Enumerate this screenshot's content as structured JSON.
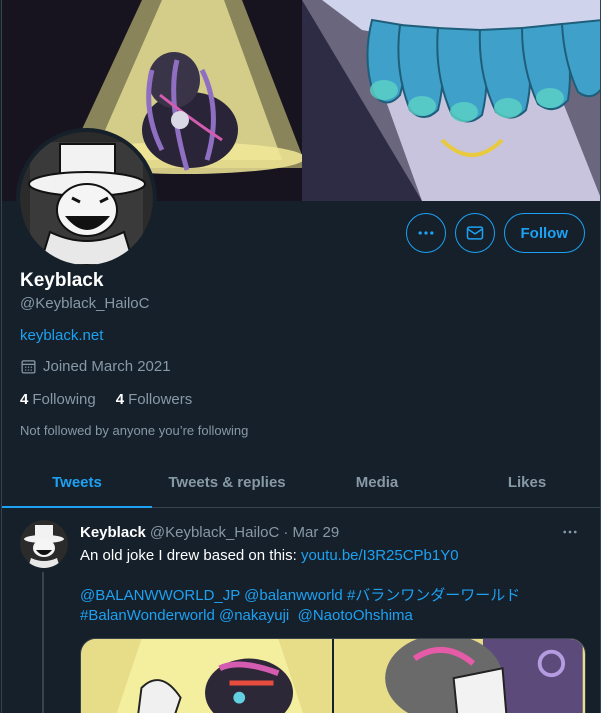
{
  "profile": {
    "name": "Keyblack",
    "handle": "@Keyblack_HailoC",
    "website": "keyblack.net",
    "joined": "Joined March 2021",
    "following_count": "4",
    "following_label": "Following",
    "followers_count": "4",
    "followers_label": "Followers",
    "not_followed": "Not followed by anyone you’re following"
  },
  "actions": {
    "more_icon": "more-horizontal-icon",
    "message_icon": "envelope-icon",
    "follow_label": "Follow"
  },
  "tabs": [
    {
      "label": "Tweets",
      "active": true
    },
    {
      "label": "Tweets & replies",
      "active": false
    },
    {
      "label": "Media",
      "active": false
    },
    {
      "label": "Likes",
      "active": false
    }
  ],
  "tweet": {
    "name": "Keyblack",
    "handle": "@Keyblack_HailoC",
    "date": "· Mar 29",
    "text": "An old joke I drew based on this:",
    "link": "youtu.be/I3R25CPb1Y0",
    "line2_a": "@BALANWWORLD_JP",
    "line2_b": "@balanwworld",
    "line2_c": "#バランワンダーワールド",
    "line3_a": "#BalanWonderworld",
    "line3_b": "@nakayuji",
    "line3_c": "@NaotoOhshima"
  },
  "colors": {
    "background": "#15202b",
    "accent": "#1da1f2",
    "secondary_text": "#8899a6",
    "border": "#38444d"
  }
}
